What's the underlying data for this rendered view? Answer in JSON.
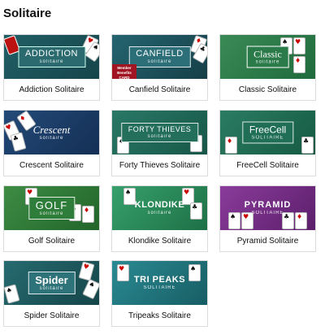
{
  "section": {
    "title": "Solitaire"
  },
  "games": [
    {
      "label": "Addiction Solitaire",
      "logo": "ADDICTION",
      "logo_sub": "solitaire",
      "bg": "#1d5b60",
      "icon": "addiction-logo"
    },
    {
      "label": "Canfield Solitaire",
      "logo": "CANFIELD",
      "logo_sub": "solitaire",
      "bg": "#1f5d66",
      "icon": "canfield-logo",
      "badge": "Member Benefits CARD"
    },
    {
      "label": "Classic Solitaire",
      "logo": "Classic",
      "logo_sub": "Solitaire",
      "bg": "#2b7a4a",
      "icon": "classic-logo"
    },
    {
      "label": "Crescent Solitaire",
      "logo": "Crescent",
      "logo_sub": "solitaire",
      "bg": "#1c3d6a",
      "icon": "crescent-logo"
    },
    {
      "label": "Forty Thieves Solitaire",
      "logo": "FORTY THIEVES",
      "logo_sub": "solitaire",
      "bg": "#1f6a5a",
      "icon": "forty-thieves-logo"
    },
    {
      "label": "FreeCell Solitaire",
      "logo": "FreeCell",
      "logo_sub": "SOLITAIRE",
      "bg": "#1f6e55",
      "icon": "freecell-logo"
    },
    {
      "label": "Golf Solitaire",
      "logo": "GOLF",
      "logo_sub": "solitaire",
      "bg": "#2f7d3a",
      "icon": "golf-logo"
    },
    {
      "label": "Klondike Solitaire",
      "logo": "KLONDIKE",
      "logo_sub": "solitaire",
      "bg": "#2b8b5c",
      "icon": "klondike-logo"
    },
    {
      "label": "Pyramid Solitaire",
      "logo": "PYRAMID",
      "logo_sub": "SOLITAIRE",
      "bg": "#7a2f8a",
      "icon": "pyramid-logo"
    },
    {
      "label": "Spider Solitaire",
      "logo": "Spider",
      "logo_sub": "solitaire",
      "bg": "#1e5f63",
      "icon": "spider-logo"
    },
    {
      "label": "Tripeaks Solitaire",
      "logo": "TRI PEAKS",
      "logo_sub": "SOLITAIRE",
      "bg": "#1d6f78",
      "icon": "tripeaks-logo"
    }
  ]
}
